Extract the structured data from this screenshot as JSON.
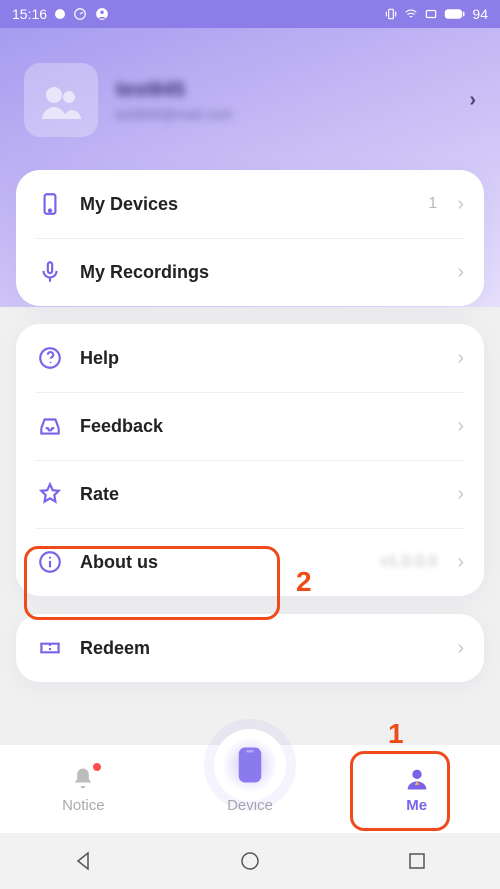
{
  "status": {
    "time": "15:16",
    "battery": "94"
  },
  "profile": {
    "name": "test845",
    "email": "test845@mail.com"
  },
  "group1": {
    "devices": {
      "label": "My Devices",
      "value": "1"
    },
    "recordings": {
      "label": "My Recordings"
    }
  },
  "group2": {
    "help": {
      "label": "Help"
    },
    "feedback": {
      "label": "Feedback"
    },
    "rate": {
      "label": "Rate"
    },
    "about": {
      "label": "About us",
      "value": "v1.0.0.0"
    }
  },
  "group3": {
    "redeem": {
      "label": "Redeem"
    }
  },
  "tabs": {
    "notice": "Notice",
    "device": "Device",
    "me": "Me"
  },
  "annotations": {
    "one": "1",
    "two": "2"
  }
}
